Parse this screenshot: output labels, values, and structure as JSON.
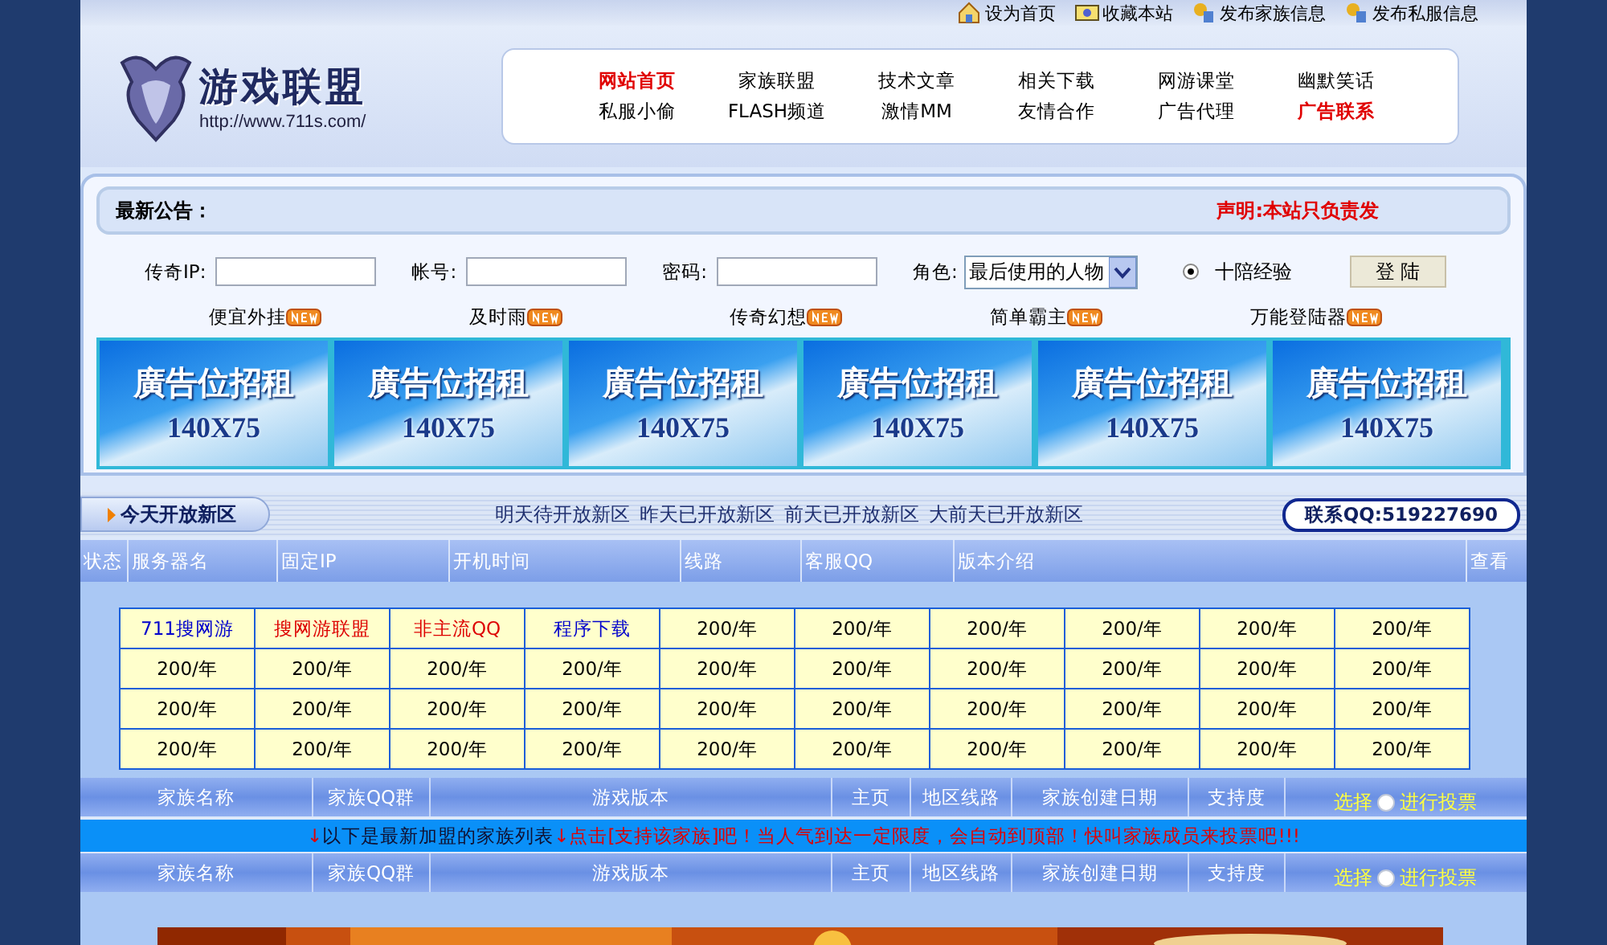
{
  "top_links": [
    {
      "label": "设为首页"
    },
    {
      "label": "收藏本站"
    },
    {
      "label": "发布家族信息"
    },
    {
      "label": "发布私服信息"
    }
  ],
  "logo": {
    "title": "游戏联盟",
    "url": "http://www.711s.com/"
  },
  "nav": [
    [
      {
        "label": "网站首页",
        "highlight": true
      },
      {
        "label": "家族联盟",
        "highlight": false
      },
      {
        "label": "技术文章",
        "highlight": false
      },
      {
        "label": "相关下载",
        "highlight": false
      },
      {
        "label": "网游课堂",
        "highlight": false
      },
      {
        "label": "幽默笑话",
        "highlight": false
      }
    ],
    [
      {
        "label": "私服小偷",
        "highlight": false
      },
      {
        "label": "FLASH频道",
        "highlight": false
      },
      {
        "label": "激情MM",
        "highlight": false
      },
      {
        "label": "友情合作",
        "highlight": false
      },
      {
        "label": "广告代理",
        "highlight": false
      },
      {
        "label": "广告联系",
        "highlight": true
      }
    ]
  ],
  "notice": {
    "title": "最新公告：",
    "statement": "声明:本站只负责发"
  },
  "login": {
    "fields": [
      {
        "label": "传奇IP:"
      },
      {
        "label": "帐号:"
      },
      {
        "label": "密码:"
      }
    ],
    "role_label": "角色:",
    "role_value": "最后使用的人物",
    "option": {
      "label": "十陪经验",
      "selected": true
    },
    "button": "登 陆"
  },
  "new_links": [
    {
      "label": "便宜外挂"
    },
    {
      "label": "及时雨"
    },
    {
      "label": "传奇幻想"
    },
    {
      "label": "简单霸主"
    },
    {
      "label": "万能登陆器"
    }
  ],
  "ads": [
    {
      "title": "廣告位招租",
      "size": "140X75"
    },
    {
      "title": "廣告位招租",
      "size": "140X75"
    },
    {
      "title": "廣告位招租",
      "size": "140X75"
    },
    {
      "title": "廣告位招租",
      "size": "140X75"
    },
    {
      "title": "廣告位招租",
      "size": "140X75"
    },
    {
      "title": "廣告位招租",
      "size": "140X75"
    }
  ],
  "server_tabs": {
    "active": "今天开放新区",
    "links": [
      "明天待开放新区",
      "昨天已开放新区",
      "前天已开放新区",
      "大前天已开放新区"
    ],
    "contact": "联系QQ:519227690"
  },
  "server_table": {
    "columns": [
      "状态",
      "服务器名",
      "固定IP",
      "开机时间",
      "线路",
      "客服QQ",
      "版本介绍",
      "查看"
    ]
  },
  "ad_grid": {
    "rows": [
      [
        {
          "text": "711搜网游",
          "color": "#0000cc"
        },
        {
          "text": "搜网游联盟",
          "color": "#dd0000"
        },
        {
          "text": "非主流QQ",
          "color": "#dd0000"
        },
        {
          "text": "程序下载",
          "color": "#0000cc"
        },
        {
          "text": "200/年"
        },
        {
          "text": "200/年"
        },
        {
          "text": "200/年"
        },
        {
          "text": "200/年"
        },
        {
          "text": "200/年"
        },
        {
          "text": "200/年"
        }
      ],
      [
        {
          "text": "200/年"
        },
        {
          "text": "200/年"
        },
        {
          "text": "200/年"
        },
        {
          "text": "200/年"
        },
        {
          "text": "200/年"
        },
        {
          "text": "200/年"
        },
        {
          "text": "200/年"
        },
        {
          "text": "200/年"
        },
        {
          "text": "200/年"
        },
        {
          "text": "200/年"
        }
      ],
      [
        {
          "text": "200/年"
        },
        {
          "text": "200/年"
        },
        {
          "text": "200/年"
        },
        {
          "text": "200/年"
        },
        {
          "text": "200/年"
        },
        {
          "text": "200/年"
        },
        {
          "text": "200/年"
        },
        {
          "text": "200/年"
        },
        {
          "text": "200/年"
        },
        {
          "text": "200/年"
        }
      ],
      [
        {
          "text": "200/年"
        },
        {
          "text": "200/年"
        },
        {
          "text": "200/年"
        },
        {
          "text": "200/年"
        },
        {
          "text": "200/年"
        },
        {
          "text": "200/年"
        },
        {
          "text": "200/年"
        },
        {
          "text": "200/年"
        },
        {
          "text": "200/年"
        },
        {
          "text": "200/年"
        }
      ]
    ]
  },
  "family_header_1": {
    "columns": [
      "家族名称",
      "家族QQ群",
      "游戏版本",
      "主页",
      "地区线路",
      "家族创建日期",
      "支持度"
    ],
    "select": "选择",
    "vote": "进行投票",
    "vote_selected": false
  },
  "family_notice": [
    {
      "text": "↓",
      "kind": "alert"
    },
    {
      "text": "以下是最新加盟的家族列表",
      "kind": "plain"
    },
    {
      "text": "↓点击[支持该家族]吧！当人气到达一定限度，会自动到顶部！快叫家族成员来投票吧!!!",
      "kind": "alert"
    }
  ],
  "family_header_2": {
    "columns": [
      "家族名称",
      "家族QQ群",
      "游戏版本",
      "主页",
      "地区线路",
      "家族创建日期",
      "支持度"
    ],
    "select": "选择",
    "vote": "进行投票",
    "vote_selected": false
  },
  "bottom_banner": {
    "kind": "picture"
  }
}
